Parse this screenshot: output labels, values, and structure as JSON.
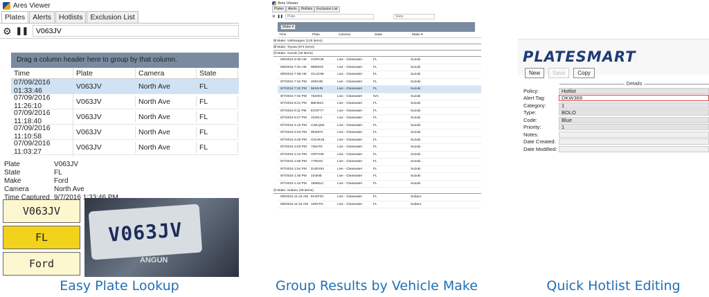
{
  "captions": {
    "p1": "Easy Plate Lookup",
    "p2": "Group Results by Vehicle Make",
    "p3": "Quick Hotlist Editing"
  },
  "p1": {
    "title": "Ares Viewer",
    "tabs": [
      "Plates",
      "Alerts",
      "Hotlists",
      "Exclusion List"
    ],
    "search_value": "V063JV",
    "group_hint": "Drag a column header here to group by that column.",
    "columns": [
      "Time",
      "Plate",
      "Camera",
      "State"
    ],
    "rows": [
      [
        "07/09/2016 01:33:46",
        "V063JV",
        "North Ave",
        "FL"
      ],
      [
        "07/09/2016 11:26:10",
        "V063JV",
        "North Ave",
        "FL"
      ],
      [
        "07/09/2016 11:18:40",
        "V063JV",
        "North Ave",
        "FL"
      ],
      [
        "07/09/2016 11:10:58",
        "V063JV",
        "North Ave",
        "FL"
      ],
      [
        "07/09/2016 11:03:27",
        "V063JV",
        "North Ave",
        "FL"
      ]
    ],
    "details": [
      {
        "k": "Plate",
        "v": "V063JV"
      },
      {
        "k": "State",
        "v": "FL"
      },
      {
        "k": "Make",
        "v": "Ford"
      },
      {
        "k": "Camera",
        "v": "North Ave"
      },
      {
        "k": "Time Captured",
        "v": "9/7/2016 1:33:46 PM"
      }
    ],
    "cards": [
      "V063JV",
      "FL",
      "Ford"
    ],
    "card_colors": [
      "#fdf7d0",
      "#f2d21b",
      "#fdf7d0"
    ],
    "photo_plate": "V063JV",
    "photo_sub": "ANGUN"
  },
  "p2": {
    "title": "Ares Viewer",
    "tabs": [
      "Plates",
      "Alerts",
      "Hotlists",
      "Exclusion List"
    ],
    "search_placeholder": "Plate",
    "state_placeholder": "State",
    "group_button": "Make ▾",
    "columns": [
      "Time",
      "Plate",
      "Camera",
      "State",
      "Make ▾"
    ],
    "groups_top": [
      "⊞ Make: Volkswagen (129 items)",
      "⊞ Make: Toyota (971 items)",
      "⊟ Make: Suzuki (18 items)"
    ],
    "rows": [
      [
        "9/8/2016 8:36 AM",
        "GXPK38",
        "Live - Clearwater",
        "FL",
        "Suzuki"
      ],
      [
        "9/8/2016 7:31 AM",
        "985MXZ",
        "Live - Clearwater",
        "FL",
        "Suzuki"
      ],
      [
        "9/8/2016 7:28 AM",
        "GLUC99",
        "Live - Clearwater",
        "FL",
        "Suzuki"
      ],
      [
        "9/7/2016 7:34 PM",
        "409X3N",
        "Live - Clearwater",
        "FL",
        "Suzuki"
      ],
      [
        "9/7/2016 7:22 PM",
        "593JHN",
        "Live - Clearwater",
        "FL",
        "Suzuki"
      ],
      [
        "9/7/2016 7:02 PM",
        "75Z303",
        "Live - Clearwater",
        "N/A",
        "Suzuki"
      ],
      [
        "9/7/2016 6:21 PM",
        "BBH844",
        "Live - Clearwater",
        "FL",
        "Suzuki"
      ],
      [
        "9/7/2016 6:11 PM",
        "EGXF77",
        "Live - Clearwater",
        "FL",
        "Suzuki"
      ],
      [
        "9/7/2016 5:47 PM",
        "103SUI",
        "Live - Clearwater",
        "FL",
        "Suzuki"
      ],
      [
        "9/7/2016 4:10 PM",
        "CWLQ84",
        "Live - Clearwater",
        "FL",
        "Suzuki"
      ],
      [
        "9/7/2016 4:03 PM",
        "993SPX",
        "Live - Clearwater",
        "FL",
        "Suzuki"
      ],
      [
        "9/7/2016 3:30 PM",
        "GGUK46",
        "Live - Clearwater",
        "FL",
        "Suzuki"
      ],
      [
        "9/7/2016 3:03 PM",
        "736ATK",
        "Live - Clearwater",
        "FL",
        "Suzuki"
      ],
      [
        "9/7/2016 2:12 PM",
        "GRTV09",
        "Live - Clearwater",
        "FL",
        "Suzuki"
      ],
      [
        "9/7/2016 1:56 PM",
        "Y78GIG",
        "Live - Clearwater",
        "FL",
        "Suzuki"
      ],
      [
        "9/7/2016 1:54 PM",
        "DUDX94",
        "Live - Clearwater",
        "FL",
        "Suzuki"
      ],
      [
        "9/7/2016 1:45 PM",
        "234INE",
        "Live - Clearwater",
        "FL",
        "Suzuki"
      ],
      [
        "9/7/2016 1:34 PM",
        "189WLC",
        "Live - Clearwater",
        "FL",
        "Suzuki"
      ]
    ],
    "group_bottom": "⊟ Make: Subaru (49 items)",
    "rows_bottom": [
      [
        "9/8/2016 11:44 AM",
        "EHXF20",
        "Live - Clearwater",
        "FL",
        "Subaru"
      ],
      [
        "9/8/2016 11:24 AM",
        "109VTN",
        "Live - Clearwater",
        "FL",
        "Subaru"
      ]
    ]
  },
  "p3": {
    "logo": "PLATESMART",
    "buttons": [
      "New",
      "Save",
      "Copy"
    ],
    "details_label": "Details",
    "fields": [
      {
        "k": "Policy:",
        "v": "Hotlist"
      },
      {
        "k": "Alert Tag:",
        "v": "DKW369"
      },
      {
        "k": "Category:",
        "v": "1"
      },
      {
        "k": "Type:",
        "v": "BOLO"
      },
      {
        "k": "Code:",
        "v": "Blue"
      },
      {
        "k": "Priority:",
        "v": "1"
      },
      {
        "k": "Notes:",
        "v": ""
      },
      {
        "k": "Date Created:",
        "v": ""
      },
      {
        "k": "Date Modified:",
        "v": ""
      }
    ]
  }
}
